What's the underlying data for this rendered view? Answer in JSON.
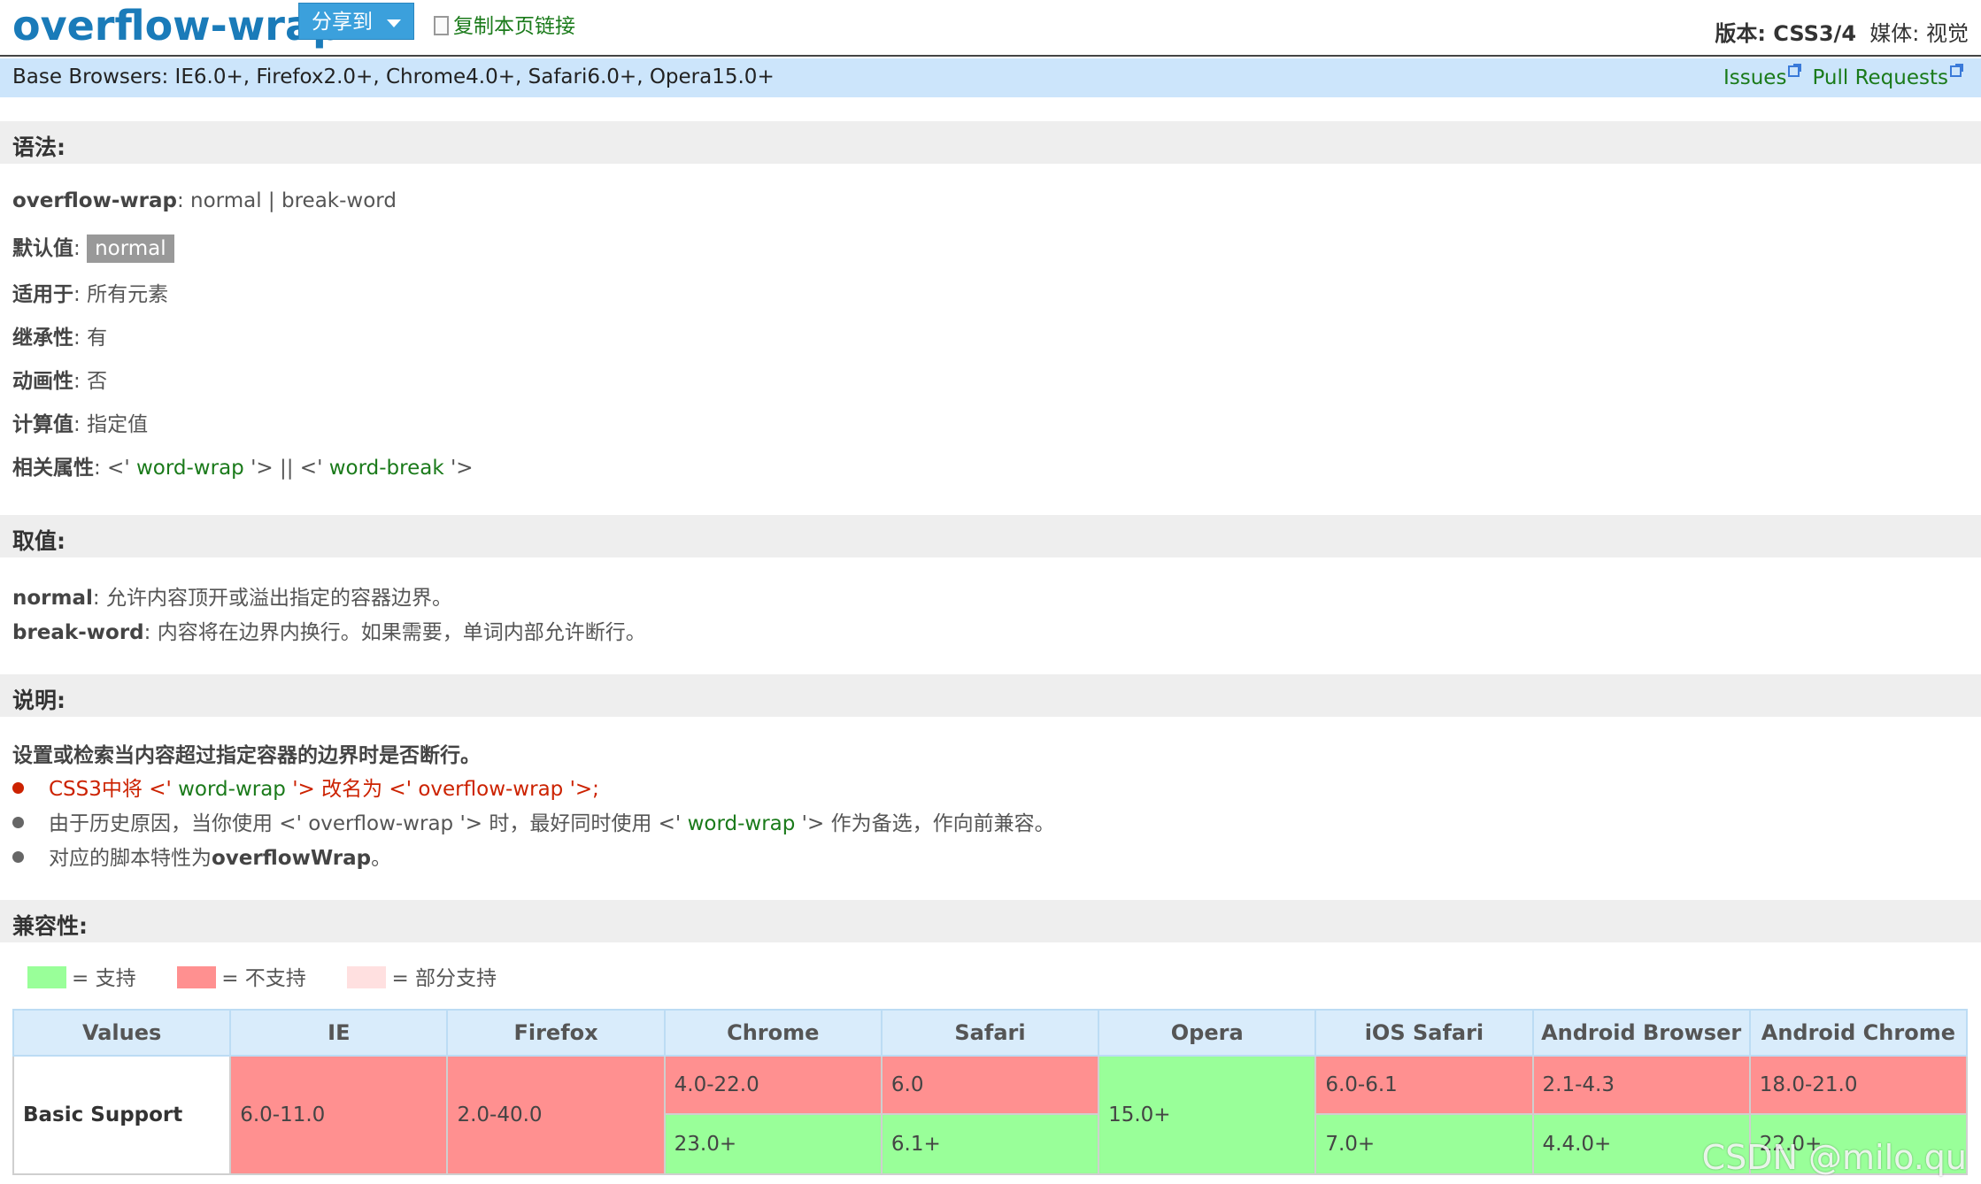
{
  "header": {
    "title": "overflow-wrap",
    "share_label": "分享到",
    "copy_link_label": "复制本页链接",
    "version_label": "版本",
    "version_value": "CSS3/4",
    "media_label": "媒体",
    "media_value": "视觉"
  },
  "browser_bar": {
    "text": "Base Browsers: IE6.0+, Firefox2.0+, Chrome4.0+, Safari6.0+, Opera15.0+",
    "issues": "Issues",
    "pull_requests": "Pull Requests"
  },
  "syntax": {
    "heading": "语法:",
    "prop": "overflow-wrap",
    "prop_values": "normal | break-word",
    "default_label": "默认值",
    "default_value": "normal",
    "applies_label": "适用于",
    "applies_value": "所有元素",
    "inherit_label": "继承性",
    "inherit_value": "有",
    "anim_label": "动画性",
    "anim_value": "否",
    "computed_label": "计算值",
    "computed_value": "指定值",
    "related_label": "相关属性",
    "related_a": "word-wrap",
    "related_sep": "'> || <'",
    "related_b": "word-break"
  },
  "values": {
    "heading": "取值:",
    "v1_name": "normal",
    "v1_desc": "允许内容顶开或溢出指定的容器边界。",
    "v2_name": "break-word",
    "v2_desc": "内容将在边界内换行。如果需要，单词内部允许断行。"
  },
  "notes": {
    "heading": "说明:",
    "summary": "设置或检索当内容超过指定容器的边界时是否断行。",
    "b1_a": "CSS3中将 <' ",
    "b1_b": "word-wrap",
    "b1_c": " '> 改名为 <' ",
    "b1_d": "overflow-wrap",
    "b1_e": " '>;",
    "b2_a": "由于历史原因，当你使用 <' overflow-wrap '> 时，最好同时使用 <' ",
    "b2_b": "word-wrap",
    "b2_c": " '> 作为备选，作向前兼容。",
    "b3_a": "对应的脚本特性为",
    "b3_b": "overflowWrap",
    "b3_c": "。"
  },
  "compat": {
    "heading": "兼容性:",
    "legend_supported": "= 支持",
    "legend_unsupported": "= 不支持",
    "legend_partial": "= 部分支持",
    "colors": {
      "supported": "#99ff99",
      "unsupported": "#ff9090",
      "partial": "#ffe0e0"
    },
    "headers": [
      "Values",
      "IE",
      "Firefox",
      "Chrome",
      "Safari",
      "Opera",
      "iOS Safari",
      "Android Browser",
      "Android Chrome"
    ],
    "row_label": "Basic Support",
    "ie": "6.0-11.0",
    "firefox": "2.0-40.0",
    "chrome_old": "4.0-22.0",
    "chrome_new": "23.0+",
    "safari_old": "6.0",
    "safari_new": "6.1+",
    "opera": "15.0+",
    "ios_old": "6.0-6.1",
    "ios_new": "7.0+",
    "android_old": "2.1-4.3",
    "android_new": "4.4.0+",
    "achrome_old": "18.0-21.0",
    "achrome_new": "22.0+"
  },
  "watermark": "CSDN @milo.qu"
}
